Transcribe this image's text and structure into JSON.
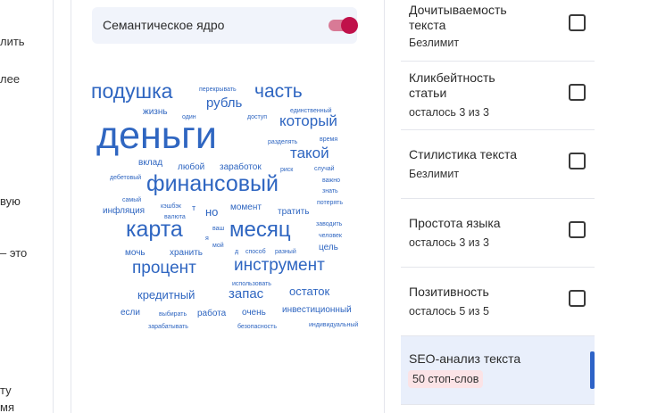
{
  "left_fragments": [
    "лить",
    "лее",
    "вую",
    "– это",
    "ту",
    "мя"
  ],
  "semantic_core": {
    "label": "Семантическое ядро",
    "enabled": true,
    "toggle_color": "#c0114a"
  },
  "word_cloud": {
    "color": "#2f66c1",
    "words": [
      "подушка",
      "перекрывать",
      "часть",
      "рубль",
      "жизнь",
      "один",
      "доступ",
      "единственный",
      "который",
      "деньги",
      "разделять",
      "время",
      "такой",
      "вклад",
      "любой",
      "заработок",
      "риск",
      "случай",
      "дебетовый",
      "финансовый",
      "важно",
      "знать",
      "самый",
      "кэшбэк",
      "т",
      "потерять",
      "инфляция",
      "валюта",
      "но",
      "момент",
      "тратить",
      "заводить",
      "карта",
      "я",
      "ваш",
      "месяц",
      "человек",
      "мой",
      "цель",
      "мочь",
      "хранить",
      "д",
      "способ",
      "разный",
      "процент",
      "инструмент",
      "использовать",
      "кредитный",
      "запас",
      "остаток",
      "если",
      "выбирать",
      "работа",
      "очень",
      "инвестиционный",
      "зарабатывать",
      "безопасность",
      "индивидуальный"
    ]
  },
  "checks": [
    {
      "title": "Дочитываемость текста",
      "status": "Безлимит"
    },
    {
      "title": "Кликбейтность статьи",
      "status": "осталось 3 из 3"
    },
    {
      "title": "Стилистика текста",
      "status": "Безлимит"
    },
    {
      "title": "Простота языка",
      "status": "осталось 3 из 3"
    },
    {
      "title": "Позитивность",
      "status": "осталось 5 из 5"
    },
    {
      "title": "SEO-анализ текста",
      "badge": "50 стоп-слов"
    }
  ]
}
